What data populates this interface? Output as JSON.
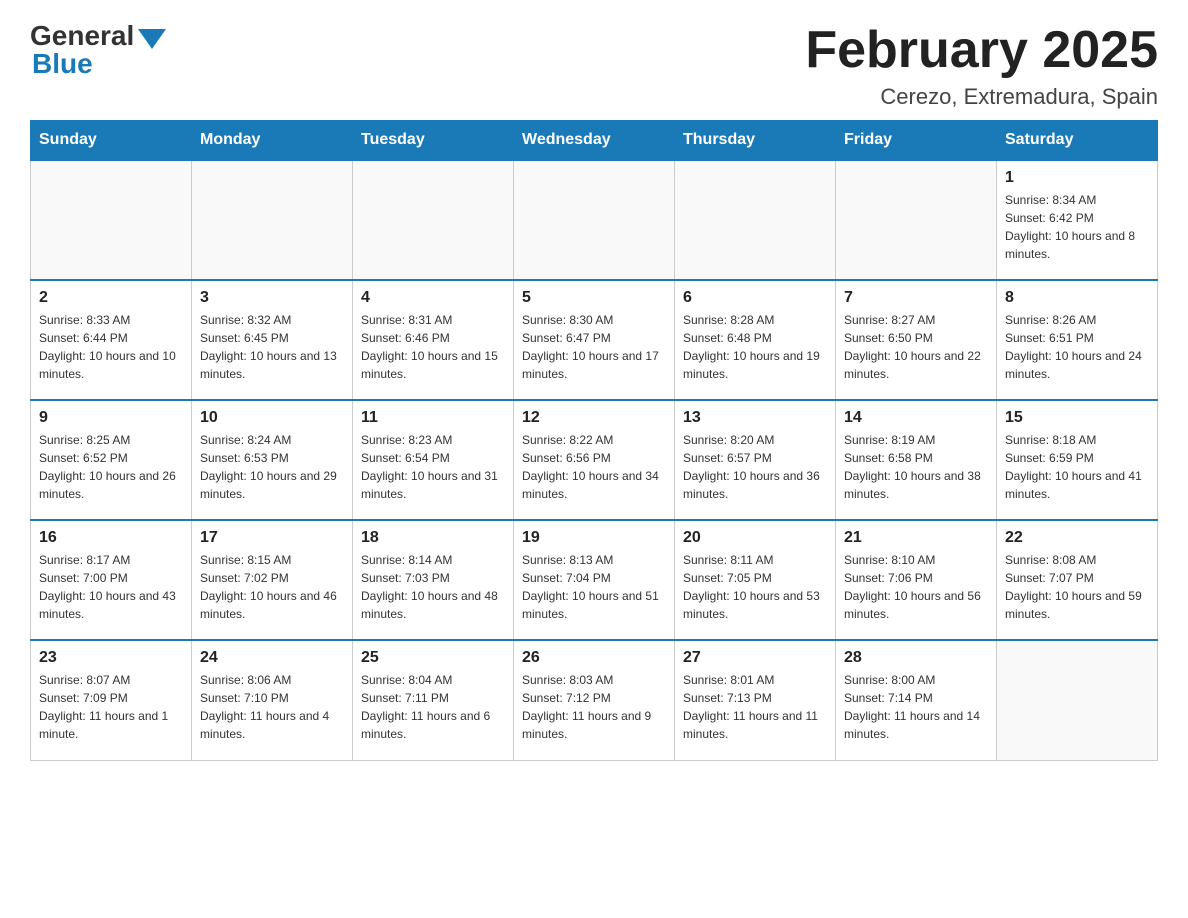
{
  "header": {
    "logo": {
      "general": "General",
      "blue": "Blue"
    },
    "title": "February 2025",
    "location": "Cerezo, Extremadura, Spain"
  },
  "days_of_week": [
    "Sunday",
    "Monday",
    "Tuesday",
    "Wednesday",
    "Thursday",
    "Friday",
    "Saturday"
  ],
  "weeks": [
    [
      null,
      null,
      null,
      null,
      null,
      null,
      {
        "day": "1",
        "sunrise": "Sunrise: 8:34 AM",
        "sunset": "Sunset: 6:42 PM",
        "daylight": "Daylight: 10 hours and 8 minutes."
      }
    ],
    [
      {
        "day": "2",
        "sunrise": "Sunrise: 8:33 AM",
        "sunset": "Sunset: 6:44 PM",
        "daylight": "Daylight: 10 hours and 10 minutes."
      },
      {
        "day": "3",
        "sunrise": "Sunrise: 8:32 AM",
        "sunset": "Sunset: 6:45 PM",
        "daylight": "Daylight: 10 hours and 13 minutes."
      },
      {
        "day": "4",
        "sunrise": "Sunrise: 8:31 AM",
        "sunset": "Sunset: 6:46 PM",
        "daylight": "Daylight: 10 hours and 15 minutes."
      },
      {
        "day": "5",
        "sunrise": "Sunrise: 8:30 AM",
        "sunset": "Sunset: 6:47 PM",
        "daylight": "Daylight: 10 hours and 17 minutes."
      },
      {
        "day": "6",
        "sunrise": "Sunrise: 8:28 AM",
        "sunset": "Sunset: 6:48 PM",
        "daylight": "Daylight: 10 hours and 19 minutes."
      },
      {
        "day": "7",
        "sunrise": "Sunrise: 8:27 AM",
        "sunset": "Sunset: 6:50 PM",
        "daylight": "Daylight: 10 hours and 22 minutes."
      },
      {
        "day": "8",
        "sunrise": "Sunrise: 8:26 AM",
        "sunset": "Sunset: 6:51 PM",
        "daylight": "Daylight: 10 hours and 24 minutes."
      }
    ],
    [
      {
        "day": "9",
        "sunrise": "Sunrise: 8:25 AM",
        "sunset": "Sunset: 6:52 PM",
        "daylight": "Daylight: 10 hours and 26 minutes."
      },
      {
        "day": "10",
        "sunrise": "Sunrise: 8:24 AM",
        "sunset": "Sunset: 6:53 PM",
        "daylight": "Daylight: 10 hours and 29 minutes."
      },
      {
        "day": "11",
        "sunrise": "Sunrise: 8:23 AM",
        "sunset": "Sunset: 6:54 PM",
        "daylight": "Daylight: 10 hours and 31 minutes."
      },
      {
        "day": "12",
        "sunrise": "Sunrise: 8:22 AM",
        "sunset": "Sunset: 6:56 PM",
        "daylight": "Daylight: 10 hours and 34 minutes."
      },
      {
        "day": "13",
        "sunrise": "Sunrise: 8:20 AM",
        "sunset": "Sunset: 6:57 PM",
        "daylight": "Daylight: 10 hours and 36 minutes."
      },
      {
        "day": "14",
        "sunrise": "Sunrise: 8:19 AM",
        "sunset": "Sunset: 6:58 PM",
        "daylight": "Daylight: 10 hours and 38 minutes."
      },
      {
        "day": "15",
        "sunrise": "Sunrise: 8:18 AM",
        "sunset": "Sunset: 6:59 PM",
        "daylight": "Daylight: 10 hours and 41 minutes."
      }
    ],
    [
      {
        "day": "16",
        "sunrise": "Sunrise: 8:17 AM",
        "sunset": "Sunset: 7:00 PM",
        "daylight": "Daylight: 10 hours and 43 minutes."
      },
      {
        "day": "17",
        "sunrise": "Sunrise: 8:15 AM",
        "sunset": "Sunset: 7:02 PM",
        "daylight": "Daylight: 10 hours and 46 minutes."
      },
      {
        "day": "18",
        "sunrise": "Sunrise: 8:14 AM",
        "sunset": "Sunset: 7:03 PM",
        "daylight": "Daylight: 10 hours and 48 minutes."
      },
      {
        "day": "19",
        "sunrise": "Sunrise: 8:13 AM",
        "sunset": "Sunset: 7:04 PM",
        "daylight": "Daylight: 10 hours and 51 minutes."
      },
      {
        "day": "20",
        "sunrise": "Sunrise: 8:11 AM",
        "sunset": "Sunset: 7:05 PM",
        "daylight": "Daylight: 10 hours and 53 minutes."
      },
      {
        "day": "21",
        "sunrise": "Sunrise: 8:10 AM",
        "sunset": "Sunset: 7:06 PM",
        "daylight": "Daylight: 10 hours and 56 minutes."
      },
      {
        "day": "22",
        "sunrise": "Sunrise: 8:08 AM",
        "sunset": "Sunset: 7:07 PM",
        "daylight": "Daylight: 10 hours and 59 minutes."
      }
    ],
    [
      {
        "day": "23",
        "sunrise": "Sunrise: 8:07 AM",
        "sunset": "Sunset: 7:09 PM",
        "daylight": "Daylight: 11 hours and 1 minute."
      },
      {
        "day": "24",
        "sunrise": "Sunrise: 8:06 AM",
        "sunset": "Sunset: 7:10 PM",
        "daylight": "Daylight: 11 hours and 4 minutes."
      },
      {
        "day": "25",
        "sunrise": "Sunrise: 8:04 AM",
        "sunset": "Sunset: 7:11 PM",
        "daylight": "Daylight: 11 hours and 6 minutes."
      },
      {
        "day": "26",
        "sunrise": "Sunrise: 8:03 AM",
        "sunset": "Sunset: 7:12 PM",
        "daylight": "Daylight: 11 hours and 9 minutes."
      },
      {
        "day": "27",
        "sunrise": "Sunrise: 8:01 AM",
        "sunset": "Sunset: 7:13 PM",
        "daylight": "Daylight: 11 hours and 11 minutes."
      },
      {
        "day": "28",
        "sunrise": "Sunrise: 8:00 AM",
        "sunset": "Sunset: 7:14 PM",
        "daylight": "Daylight: 11 hours and 14 minutes."
      },
      null
    ]
  ]
}
